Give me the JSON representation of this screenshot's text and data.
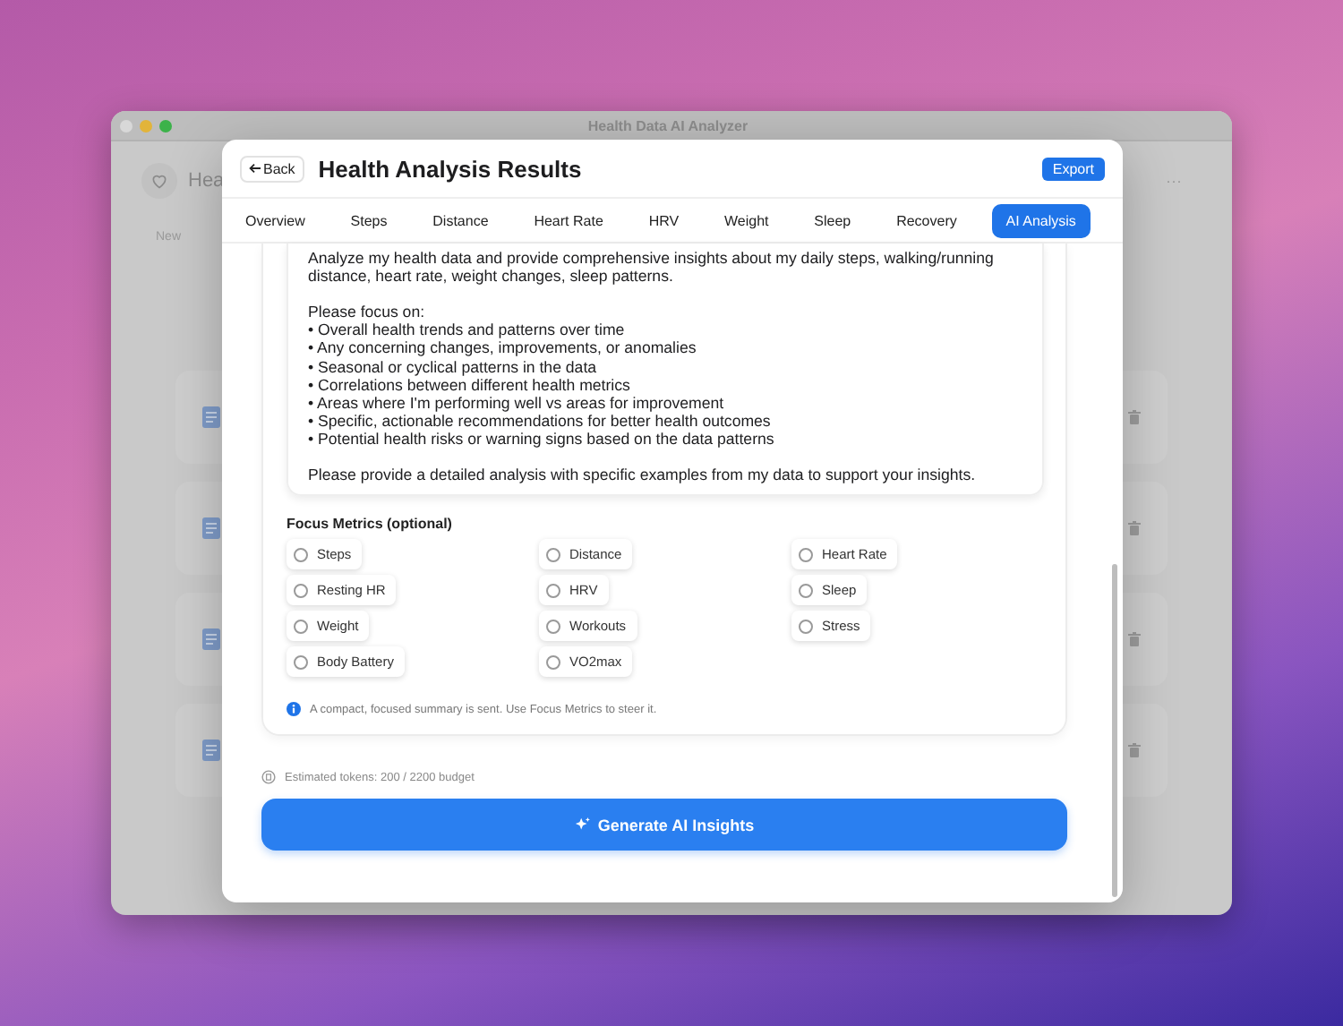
{
  "window": {
    "title": "Health Data AI Analyzer"
  },
  "background_app": {
    "heading": "Hea",
    "new_label": "New",
    "more": "···",
    "cards": [
      {
        "kind": "document"
      },
      {
        "kind": "document"
      },
      {
        "kind": "document"
      },
      {
        "kind": "document"
      }
    ]
  },
  "dialog": {
    "back": "Back",
    "title": "Health Analysis Results",
    "export": "Export",
    "tabs": [
      {
        "label": "Overview",
        "selected": false
      },
      {
        "label": "Steps",
        "selected": false
      },
      {
        "label": "Distance",
        "selected": false
      },
      {
        "label": "Heart Rate",
        "selected": false
      },
      {
        "label": "HRV",
        "selected": false
      },
      {
        "label": "Weight",
        "selected": false
      },
      {
        "label": "Sleep",
        "selected": false
      },
      {
        "label": "Recovery",
        "selected": false
      },
      {
        "label": "AI Analysis",
        "selected": true
      }
    ],
    "prompt": {
      "value": "Analyze my health data and provide comprehensive insights about my daily steps, walking/running\ndistance, heart rate, weight changes, sleep patterns.\n\nPlease focus on:\n• Overall health trends and patterns over time\n• Any concerning changes, improvements, or anomalies\n• Seasonal or cyclical patterns in the data\n• Correlations between different health metrics\n• Areas where I'm performing well vs areas for improvement\n• Specific, actionable recommendations for better health outcomes\n• Potential health risks or warning signs based on the data patterns\n\nPlease provide a detailed analysis with specific examples from my data to support your insights."
    },
    "focus_title": "Focus Metrics (optional)",
    "metrics": [
      {
        "label": "Steps",
        "selected": false
      },
      {
        "label": "Distance",
        "selected": false
      },
      {
        "label": "Heart Rate",
        "selected": false
      },
      {
        "label": "Resting HR",
        "selected": false
      },
      {
        "label": "HRV",
        "selected": false
      },
      {
        "label": "Sleep",
        "selected": false
      },
      {
        "label": "Weight",
        "selected": false
      },
      {
        "label": "Workouts",
        "selected": false
      },
      {
        "label": "Stress",
        "selected": false
      },
      {
        "label": "Body Battery",
        "selected": false
      },
      {
        "label": "VO2max",
        "selected": false
      }
    ],
    "info": "A compact, focused summary is sent. Use Focus Metrics to steer it.",
    "tokens": "Estimated tokens: 200 / 2200 budget",
    "generate": "Generate AI Insights"
  }
}
